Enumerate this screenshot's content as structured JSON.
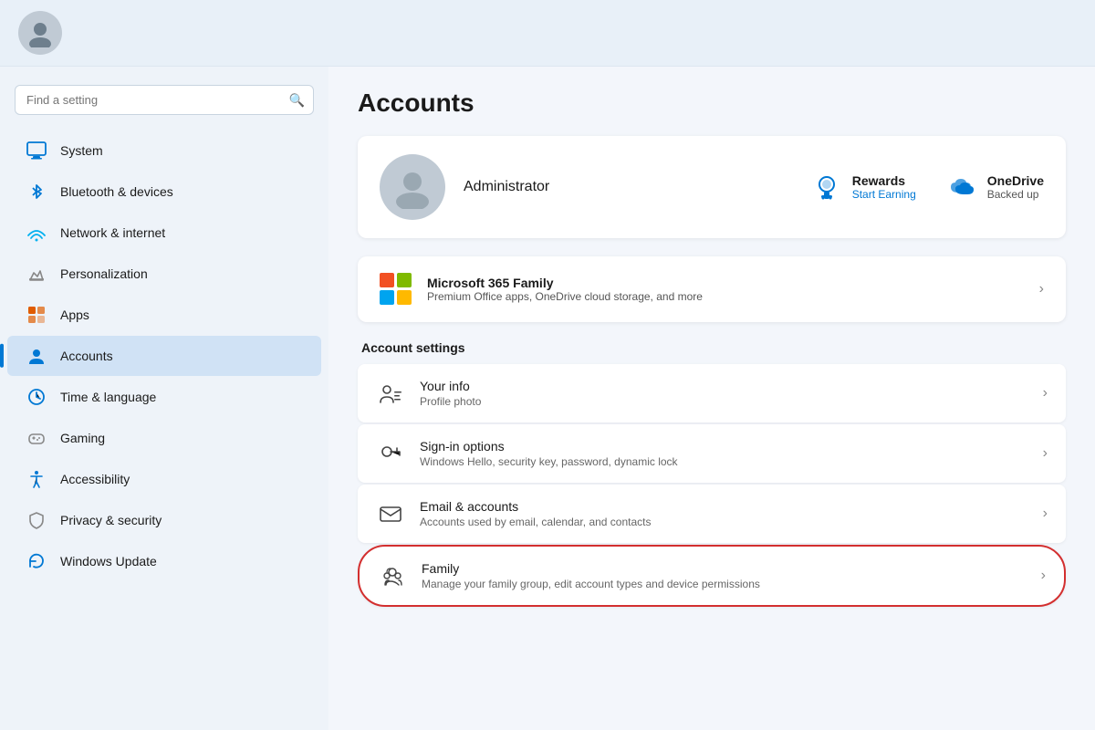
{
  "header": {
    "avatar_label": "User avatar"
  },
  "sidebar": {
    "search": {
      "placeholder": "Find a setting",
      "value": ""
    },
    "nav_items": [
      {
        "id": "system",
        "label": "System",
        "icon": "🖥",
        "icon_class": "icon-system",
        "active": false
      },
      {
        "id": "bluetooth",
        "label": "Bluetooth & devices",
        "icon": "⬡",
        "icon_class": "icon-bluetooth",
        "active": false
      },
      {
        "id": "network",
        "label": "Network & internet",
        "icon": "◈",
        "icon_class": "icon-network",
        "active": false
      },
      {
        "id": "personalization",
        "label": "Personalization",
        "icon": "✏",
        "icon_class": "icon-personalization",
        "active": false
      },
      {
        "id": "apps",
        "label": "Apps",
        "icon": "⊞",
        "icon_class": "icon-apps",
        "active": false
      },
      {
        "id": "accounts",
        "label": "Accounts",
        "icon": "◉",
        "icon_class": "icon-accounts",
        "active": true
      },
      {
        "id": "time",
        "label": "Time & language",
        "icon": "⊕",
        "icon_class": "icon-time",
        "active": false
      },
      {
        "id": "gaming",
        "label": "Gaming",
        "icon": "⊛",
        "icon_class": "icon-gaming",
        "active": false
      },
      {
        "id": "accessibility",
        "label": "Accessibility",
        "icon": "✳",
        "icon_class": "icon-accessibility",
        "active": false
      },
      {
        "id": "privacy",
        "label": "Privacy & security",
        "icon": "⊘",
        "icon_class": "icon-privacy",
        "active": false
      },
      {
        "id": "update",
        "label": "Windows Update",
        "icon": "↻",
        "icon_class": "icon-update",
        "active": false
      }
    ]
  },
  "content": {
    "page_title": "Accounts",
    "profile": {
      "name": "Administrator",
      "rewards": {
        "title": "Rewards",
        "subtitle": "Start Earning"
      },
      "onedrive": {
        "title": "OneDrive",
        "subtitle": "Backed up"
      }
    },
    "m365": {
      "title": "Microsoft 365 Family",
      "subtitle": "Premium Office apps, OneDrive cloud storage, and more"
    },
    "account_settings_title": "Account settings",
    "settings_items": [
      {
        "id": "your-info",
        "title": "Your info",
        "subtitle": "Profile photo",
        "icon_type": "person-card"
      },
      {
        "id": "sign-in",
        "title": "Sign-in options",
        "subtitle": "Windows Hello, security key, password, dynamic lock",
        "icon_type": "key"
      },
      {
        "id": "email-accounts",
        "title": "Email & accounts",
        "subtitle": "Accounts used by email, calendar, and contacts",
        "icon_type": "envelope"
      },
      {
        "id": "family",
        "title": "Family",
        "subtitle": "Manage your family group, edit account types and device permissions",
        "icon_type": "family",
        "highlighted": true
      }
    ]
  }
}
